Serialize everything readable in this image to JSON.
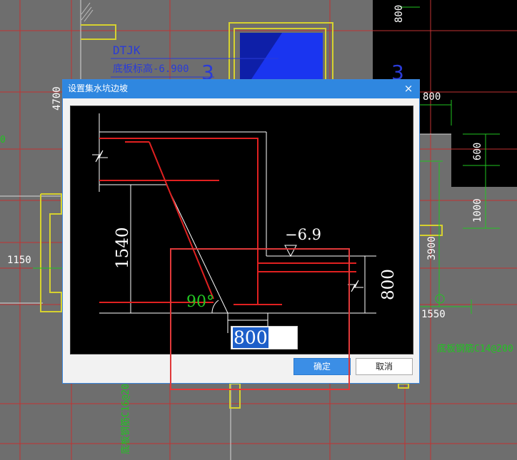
{
  "background_cad": {
    "labels": {
      "dtjk": "DTJK",
      "elevation": "底板标高-6.900",
      "zone_left": "3",
      "zone_right": "3",
      "dim_800_top": "800",
      "dim_4700": "4700",
      "dim_800_right": "800",
      "dim_600": "600",
      "dim_1000": "1000",
      "dim_3900": "3900",
      "dim_1150": "1150",
      "dim_1550": "1550",
      "rebar_right": "底板钢筋C14@200",
      "rebar_bottom": "底板钢筋C16@200",
      "edge_zero": "0"
    }
  },
  "dialog": {
    "title": "设置集水坑边坡",
    "close_glyph": "×",
    "diagram": {
      "depth_label": "1540",
      "angle_label": "90°",
      "elevation_label": "−6.9",
      "right_dim_label": "800"
    },
    "width_input": {
      "value": "800"
    },
    "ok_label": "确定",
    "cancel_label": "取消"
  }
}
